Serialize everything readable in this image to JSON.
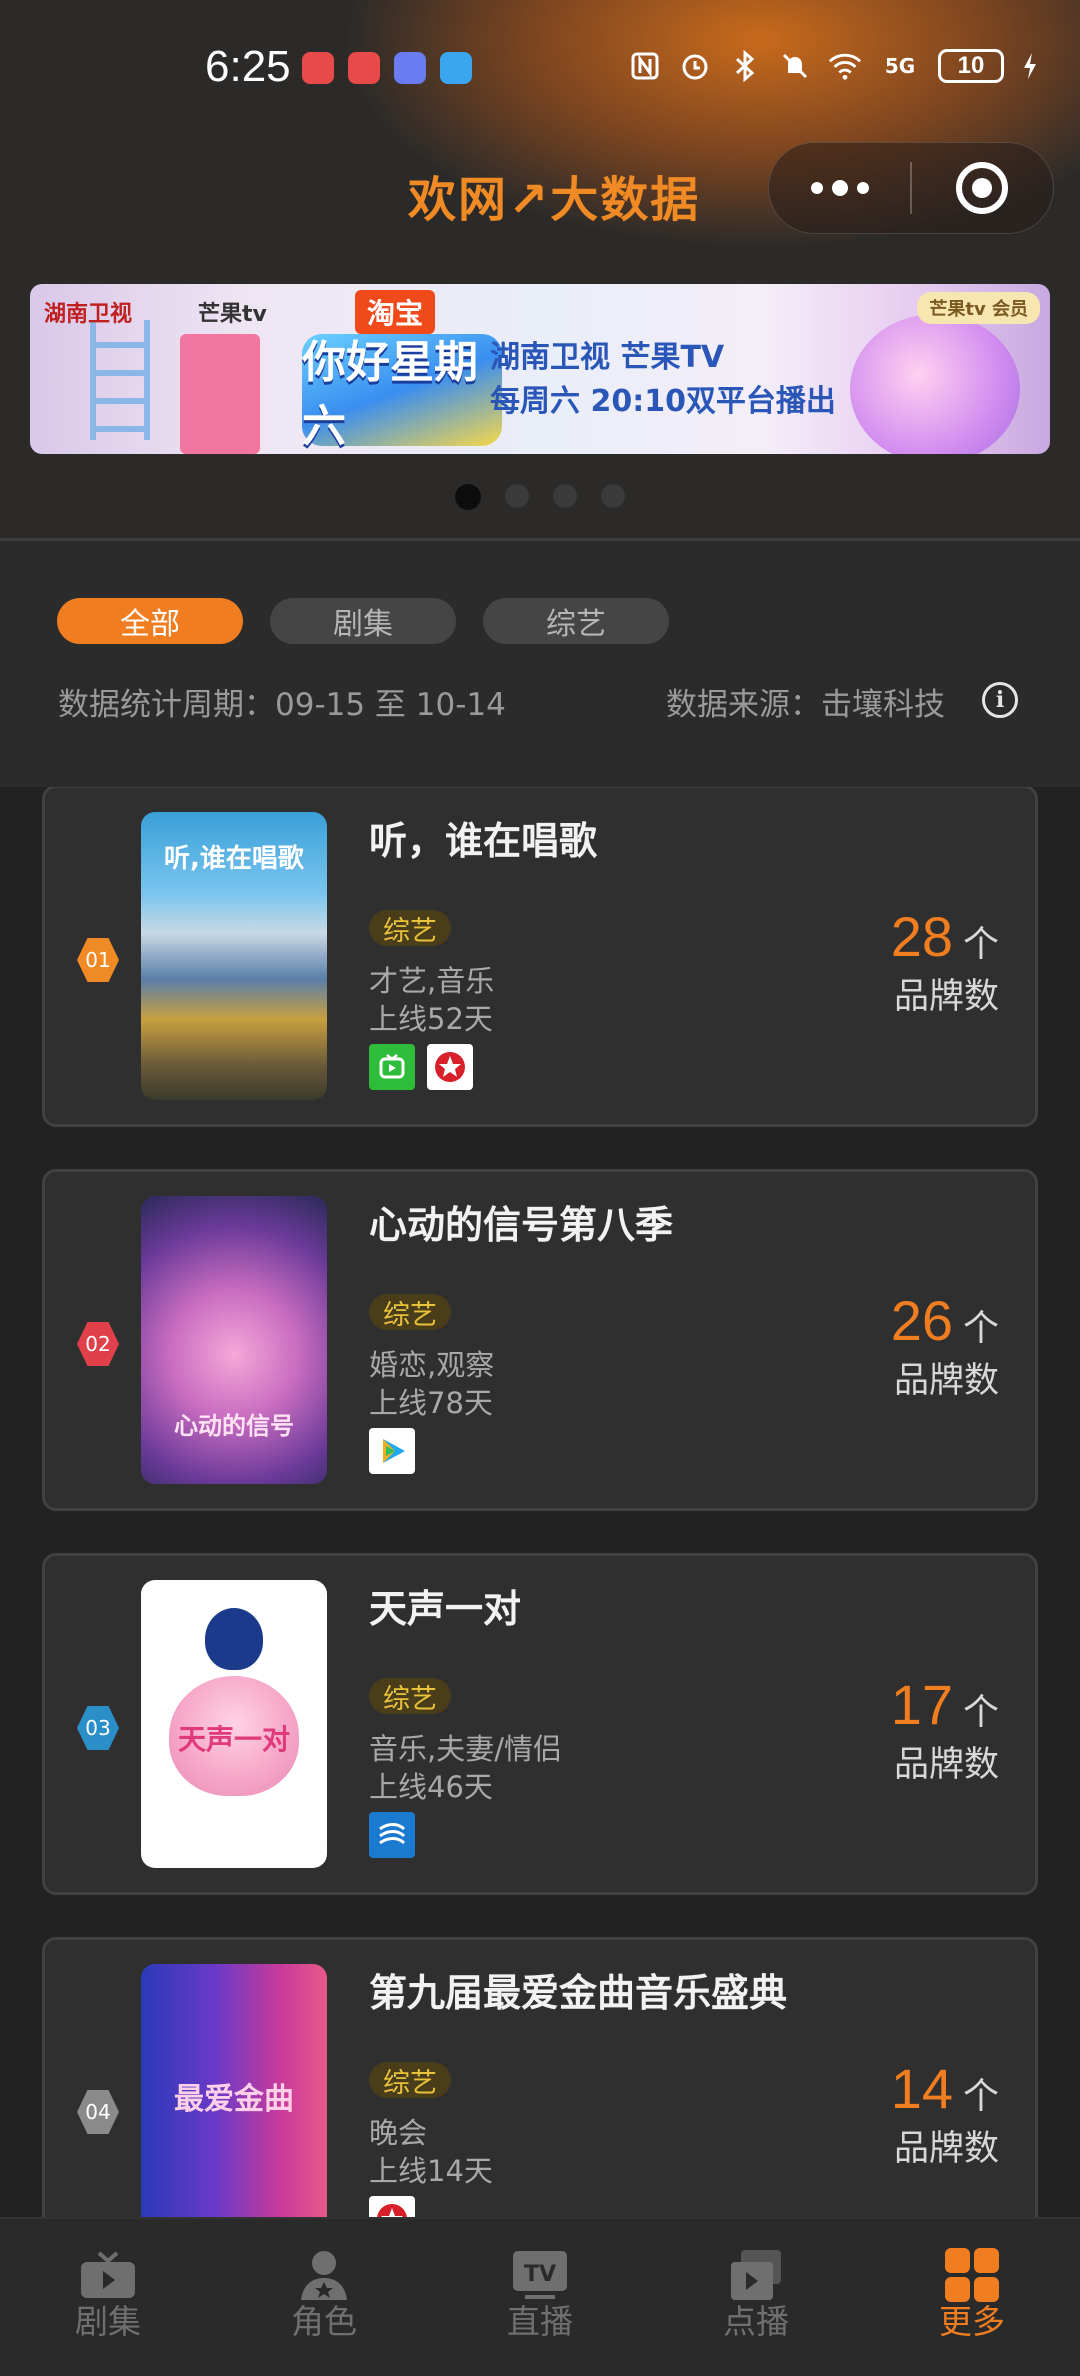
{
  "status_bar": {
    "time": "6:25",
    "network": "5G",
    "battery": "10"
  },
  "header": {
    "brand": "欢网↗大数据",
    "more_icon": "more-dots-icon",
    "target_icon": "target-icon"
  },
  "banner": {
    "logo_left": "湖南卫视",
    "logo_mango": "芒果tv",
    "taobao": "淘宝",
    "show_logo": "你好星期六",
    "line1": "湖南卫视 芒果TV",
    "line2": "每周六 20:10双平台播出",
    "badge": "芒果tv 会员",
    "pages": 4,
    "active_page": 1
  },
  "filters": {
    "tabs": [
      {
        "label": "全部",
        "active": true
      },
      {
        "label": "剧集",
        "active": false
      },
      {
        "label": "综艺",
        "active": false
      }
    ],
    "period": "数据统计周期：09-15 至 10-14",
    "source": "数据来源：击壤科技"
  },
  "items": [
    {
      "rank": "01",
      "rank_color": "#f08a24",
      "title": "听，谁在唱歌",
      "tag": "综艺",
      "genres": "才艺,音乐",
      "days": "上线52天",
      "count": "28",
      "unit": "个",
      "count_label": "品牌数",
      "poster_text": "听,谁在唱歌",
      "platforms": [
        "iqiyi-icon",
        "dragon-tv-icon"
      ]
    },
    {
      "rank": "02",
      "rank_color": "#e0404a",
      "title": "心动的信号第八季",
      "tag": "综艺",
      "genres": "婚恋,观察",
      "days": "上线78天",
      "count": "26",
      "unit": "个",
      "count_label": "品牌数",
      "poster_text": "心动的信号",
      "platforms": [
        "tencent-video-icon"
      ]
    },
    {
      "rank": "03",
      "rank_color": "#2a8fc8",
      "title": "天声一对",
      "tag": "综艺",
      "genres": "音乐,夫妻/情侣",
      "days": "上线46天",
      "count": "17",
      "unit": "个",
      "count_label": "品牌数",
      "poster_text": "天声一对",
      "platforms": [
        "zhejiang-tv-icon"
      ]
    },
    {
      "rank": "04",
      "rank_color": "#8a8a8a",
      "title": "第九届最爱金曲音乐盛典",
      "tag": "综艺",
      "genres": "晚会",
      "days": "上线14天",
      "count": "14",
      "unit": "个",
      "count_label": "品牌数",
      "poster_text": "最爱金曲",
      "platforms": [
        "dragon-tv-icon"
      ]
    }
  ],
  "bottom_nav": [
    {
      "label": "剧集",
      "icon": "tv-icon",
      "active": false
    },
    {
      "label": "角色",
      "icon": "person-star-icon",
      "active": false
    },
    {
      "label": "直播",
      "icon": "tv-live-icon",
      "active": false
    },
    {
      "label": "点播",
      "icon": "play-stack-icon",
      "active": false
    },
    {
      "label": "更多",
      "icon": "grid-icon",
      "active": true
    }
  ],
  "colors": {
    "accent": "#f07d20",
    "tag_text": "#e9c23a",
    "background": "#222222",
    "card": "#2f2f2f"
  }
}
